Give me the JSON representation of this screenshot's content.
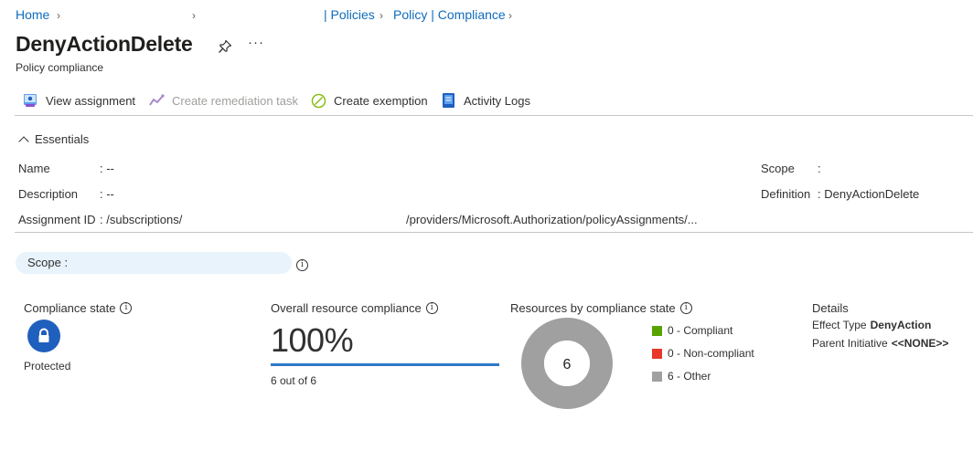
{
  "breadcrumb": {
    "home": "Home",
    "policies": "| Policies",
    "policy_compliance": "Policy | Compliance"
  },
  "header": {
    "title": "DenyActionDelete",
    "subtitle": "Policy compliance",
    "more": "···"
  },
  "toolbar": {
    "view_assignment": "View assignment",
    "create_remediation": "Create remediation task",
    "create_exemption": "Create exemption",
    "activity_logs": "Activity Logs"
  },
  "essentials": {
    "toggle_label": "Essentials",
    "name_label": "Name",
    "name_value": ": --",
    "description_label": "Description",
    "description_value": ": --",
    "assignment_id_label": "Assignment ID",
    "assignment_id_value_start": ": /subscriptions/",
    "assignment_id_value_end": "/providers/Microsoft.Authorization/policyAssignments/...",
    "scope_label": "Scope",
    "scope_value": ":",
    "definition_label": "Definition",
    "definition_value": ": DenyActionDelete"
  },
  "scope_filter": {
    "label": "Scope :"
  },
  "compliance_state": {
    "title": "Compliance state",
    "value": "Protected"
  },
  "overall_compliance": {
    "title": "Overall resource compliance",
    "percent_text": "100%",
    "percent": 100,
    "summary": "6 out of 6"
  },
  "resources_by_state": {
    "title": "Resources by compliance state",
    "total": "6",
    "legend": [
      {
        "label": "0 - Compliant",
        "count": 0,
        "color": "#57a300"
      },
      {
        "label": "0 - Non-compliant",
        "count": 0,
        "color": "#e8382a"
      },
      {
        "label": "6 - Other",
        "count": 6,
        "color": "#a0a0a0"
      }
    ]
  },
  "details": {
    "title": "Details",
    "effect_type_label": "Effect Type",
    "effect_type_value": "DenyAction",
    "parent_initiative_label": "Parent Initiative",
    "parent_initiative_value": "<<NONE>>"
  },
  "colors": {
    "link": "#0f6cbd",
    "accent": "#1f5fbd",
    "bar": "#2f78c8",
    "pill": "#e8f3fc"
  }
}
